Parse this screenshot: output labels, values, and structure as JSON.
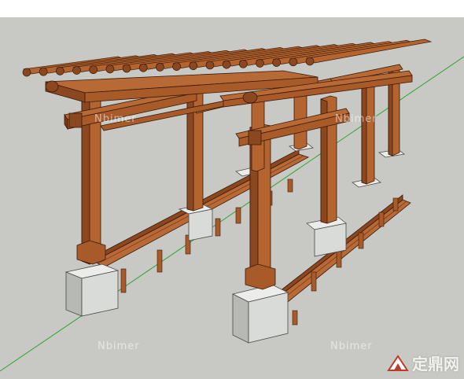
{
  "scene": {
    "background_color": "#c8c9c4",
    "wood_color": "#b4642f",
    "wood_dark": "#7a3a16",
    "stone_color": "#d9dbd8",
    "axis_color": "#2fa32f"
  },
  "watermarks": [
    {
      "text": "Nbimer"
    },
    {
      "text": "Nbimer"
    },
    {
      "text": "Nbimer"
    },
    {
      "text": "Nbimer"
    }
  ],
  "brand": {
    "text": "定鼎网",
    "icon": "logo-icon"
  }
}
